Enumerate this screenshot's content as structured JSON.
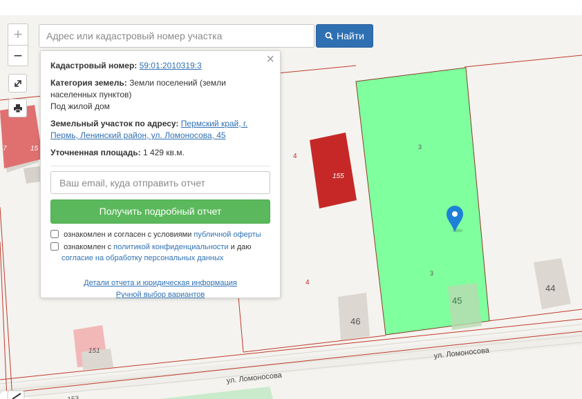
{
  "map": {
    "street_labels": [
      "ул. Ломоносова",
      "ул. Ломоносова"
    ],
    "plot_numbers": [
      "3",
      "3",
      "4",
      "4"
    ],
    "building_numbers": [
      "155",
      "45",
      "46",
      "44",
      "151",
      "15",
      "7"
    ],
    "partial_label_bottom": "153",
    "selected_parcel_color": "#80ff9e",
    "building_red_color": "#c62828",
    "marker_color": "#1e7fd6"
  },
  "controls": {
    "zoom_in": "+",
    "zoom_out": "−",
    "fullscreen_icon": "expand-arrows-icon",
    "print_icon": "printer-icon",
    "edit_icon": "pencil-icon"
  },
  "search": {
    "placeholder": "Адрес или кадастровый номер участка",
    "button_label": "Найти",
    "button_icon": "search-icon"
  },
  "popup": {
    "close": "×",
    "cadastral_label": "Кадастровый номер:",
    "cadastral_value": "59:01:2010319:3",
    "category_label": "Категория земель:",
    "category_value": "Земли поселений (земли населенных пунктов)",
    "purpose": "Под жилой дом",
    "address_label": "Земельный участок по адресу:",
    "address_value": "Пермский край, г. Пермь, Ленинский район, ул. Ломоносова, 45",
    "area_label": "Уточненная площадь:",
    "area_value": "1 429 кв.м.",
    "email_placeholder": "Ваш email, куда отправить отчет",
    "report_button": "Получить подробный отчет",
    "consent1_text": "ознакомлен и согласен с условиями",
    "consent1_link": "публичной оферты",
    "consent2_text_a": "ознакомлен с",
    "consent2_link_a": "политикой конфиденциальности",
    "consent2_text_b": "и даю",
    "consent2_link_b": "согласие на обработку персональных данных",
    "link_details": "Детали отчета и юридическая информация",
    "link_manual": "Ручной выбор вариантов"
  }
}
